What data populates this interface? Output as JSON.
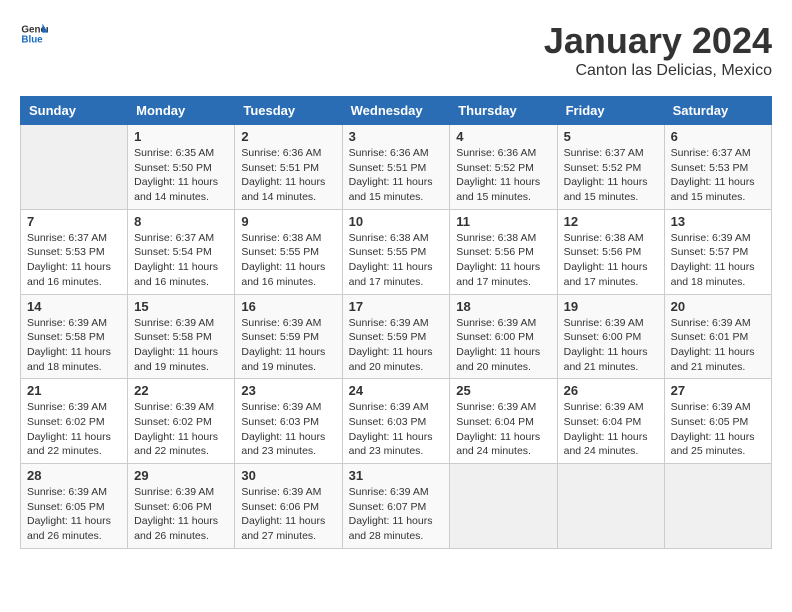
{
  "header": {
    "logo_general": "General",
    "logo_blue": "Blue",
    "month_title": "January 2024",
    "location": "Canton las Delicias, Mexico"
  },
  "days_of_week": [
    "Sunday",
    "Monday",
    "Tuesday",
    "Wednesday",
    "Thursday",
    "Friday",
    "Saturday"
  ],
  "weeks": [
    [
      {
        "day": "",
        "info": ""
      },
      {
        "day": "1",
        "info": "Sunrise: 6:35 AM\nSunset: 5:50 PM\nDaylight: 11 hours\nand 14 minutes."
      },
      {
        "day": "2",
        "info": "Sunrise: 6:36 AM\nSunset: 5:51 PM\nDaylight: 11 hours\nand 14 minutes."
      },
      {
        "day": "3",
        "info": "Sunrise: 6:36 AM\nSunset: 5:51 PM\nDaylight: 11 hours\nand 15 minutes."
      },
      {
        "day": "4",
        "info": "Sunrise: 6:36 AM\nSunset: 5:52 PM\nDaylight: 11 hours\nand 15 minutes."
      },
      {
        "day": "5",
        "info": "Sunrise: 6:37 AM\nSunset: 5:52 PM\nDaylight: 11 hours\nand 15 minutes."
      },
      {
        "day": "6",
        "info": "Sunrise: 6:37 AM\nSunset: 5:53 PM\nDaylight: 11 hours\nand 15 minutes."
      }
    ],
    [
      {
        "day": "7",
        "info": "Sunrise: 6:37 AM\nSunset: 5:53 PM\nDaylight: 11 hours\nand 16 minutes."
      },
      {
        "day": "8",
        "info": "Sunrise: 6:37 AM\nSunset: 5:54 PM\nDaylight: 11 hours\nand 16 minutes."
      },
      {
        "day": "9",
        "info": "Sunrise: 6:38 AM\nSunset: 5:55 PM\nDaylight: 11 hours\nand 16 minutes."
      },
      {
        "day": "10",
        "info": "Sunrise: 6:38 AM\nSunset: 5:55 PM\nDaylight: 11 hours\nand 17 minutes."
      },
      {
        "day": "11",
        "info": "Sunrise: 6:38 AM\nSunset: 5:56 PM\nDaylight: 11 hours\nand 17 minutes."
      },
      {
        "day": "12",
        "info": "Sunrise: 6:38 AM\nSunset: 5:56 PM\nDaylight: 11 hours\nand 17 minutes."
      },
      {
        "day": "13",
        "info": "Sunrise: 6:39 AM\nSunset: 5:57 PM\nDaylight: 11 hours\nand 18 minutes."
      }
    ],
    [
      {
        "day": "14",
        "info": "Sunrise: 6:39 AM\nSunset: 5:58 PM\nDaylight: 11 hours\nand 18 minutes."
      },
      {
        "day": "15",
        "info": "Sunrise: 6:39 AM\nSunset: 5:58 PM\nDaylight: 11 hours\nand 19 minutes."
      },
      {
        "day": "16",
        "info": "Sunrise: 6:39 AM\nSunset: 5:59 PM\nDaylight: 11 hours\nand 19 minutes."
      },
      {
        "day": "17",
        "info": "Sunrise: 6:39 AM\nSunset: 5:59 PM\nDaylight: 11 hours\nand 20 minutes."
      },
      {
        "day": "18",
        "info": "Sunrise: 6:39 AM\nSunset: 6:00 PM\nDaylight: 11 hours\nand 20 minutes."
      },
      {
        "day": "19",
        "info": "Sunrise: 6:39 AM\nSunset: 6:00 PM\nDaylight: 11 hours\nand 21 minutes."
      },
      {
        "day": "20",
        "info": "Sunrise: 6:39 AM\nSunset: 6:01 PM\nDaylight: 11 hours\nand 21 minutes."
      }
    ],
    [
      {
        "day": "21",
        "info": "Sunrise: 6:39 AM\nSunset: 6:02 PM\nDaylight: 11 hours\nand 22 minutes."
      },
      {
        "day": "22",
        "info": "Sunrise: 6:39 AM\nSunset: 6:02 PM\nDaylight: 11 hours\nand 22 minutes."
      },
      {
        "day": "23",
        "info": "Sunrise: 6:39 AM\nSunset: 6:03 PM\nDaylight: 11 hours\nand 23 minutes."
      },
      {
        "day": "24",
        "info": "Sunrise: 6:39 AM\nSunset: 6:03 PM\nDaylight: 11 hours\nand 23 minutes."
      },
      {
        "day": "25",
        "info": "Sunrise: 6:39 AM\nSunset: 6:04 PM\nDaylight: 11 hours\nand 24 minutes."
      },
      {
        "day": "26",
        "info": "Sunrise: 6:39 AM\nSunset: 6:04 PM\nDaylight: 11 hours\nand 24 minutes."
      },
      {
        "day": "27",
        "info": "Sunrise: 6:39 AM\nSunset: 6:05 PM\nDaylight: 11 hours\nand 25 minutes."
      }
    ],
    [
      {
        "day": "28",
        "info": "Sunrise: 6:39 AM\nSunset: 6:05 PM\nDaylight: 11 hours\nand 26 minutes."
      },
      {
        "day": "29",
        "info": "Sunrise: 6:39 AM\nSunset: 6:06 PM\nDaylight: 11 hours\nand 26 minutes."
      },
      {
        "day": "30",
        "info": "Sunrise: 6:39 AM\nSunset: 6:06 PM\nDaylight: 11 hours\nand 27 minutes."
      },
      {
        "day": "31",
        "info": "Sunrise: 6:39 AM\nSunset: 6:07 PM\nDaylight: 11 hours\nand 28 minutes."
      },
      {
        "day": "",
        "info": ""
      },
      {
        "day": "",
        "info": ""
      },
      {
        "day": "",
        "info": ""
      }
    ]
  ]
}
